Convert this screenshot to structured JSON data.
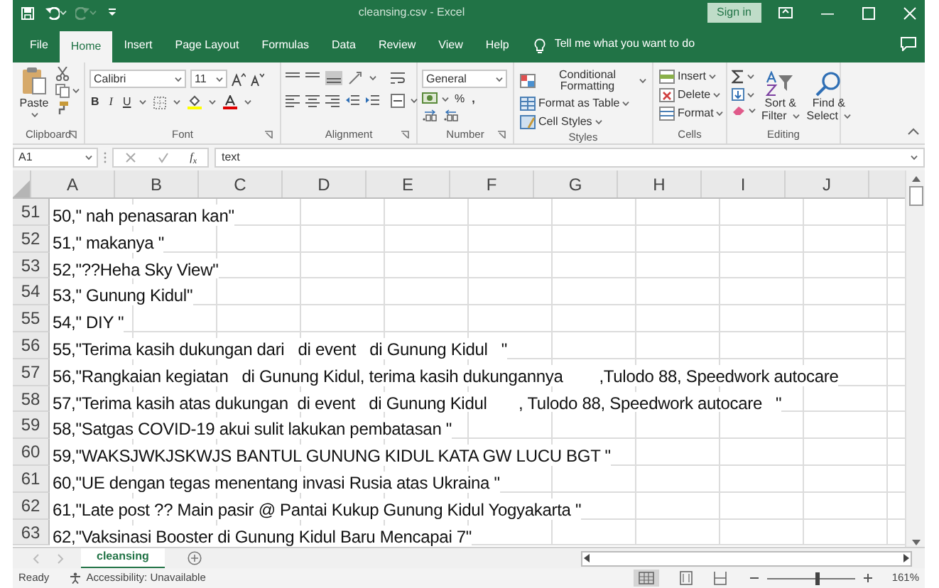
{
  "title_bar": {
    "title": "cleansing.csv  -  Excel",
    "sign_in": "Sign in"
  },
  "ribbon_tabs": [
    {
      "label": "File",
      "selected": false
    },
    {
      "label": "Home",
      "selected": true
    },
    {
      "label": "Insert",
      "selected": false
    },
    {
      "label": "Page Layout",
      "selected": false
    },
    {
      "label": "Formulas",
      "selected": false
    },
    {
      "label": "Data",
      "selected": false
    },
    {
      "label": "Review",
      "selected": false
    },
    {
      "label": "View",
      "selected": false
    },
    {
      "label": "Help",
      "selected": false
    }
  ],
  "tell_me": "Tell me what you want to do",
  "ribbon": {
    "clipboard": {
      "paste": "Paste",
      "label": "Clipboard"
    },
    "font": {
      "font_name": "Calibri",
      "font_size": "11",
      "bold": "B",
      "italic": "I",
      "underline": "U",
      "label": "Font"
    },
    "alignment": {
      "label": "Alignment"
    },
    "number": {
      "format": "General",
      "percent": "%",
      "comma": ",",
      "label": "Number"
    },
    "styles": {
      "items": [
        "Conditional Formatting",
        "Format as Table",
        "Cell Styles"
      ],
      "label": "Styles"
    },
    "cells": {
      "items": [
        "Insert",
        "Delete",
        "Format"
      ],
      "label": "Cells"
    },
    "editing": {
      "sort": [
        "Sort &",
        "Filter"
      ],
      "find": [
        "Find &",
        "Select"
      ],
      "label": "Editing"
    }
  },
  "formula_bar": {
    "name_box": "A1",
    "fx": "f$_{x}$",
    "value": "text"
  },
  "columns": [
    "A",
    "B",
    "C",
    "D",
    "E",
    "F",
    "G",
    "H",
    "I",
    "J"
  ],
  "rows": [
    {
      "number": "51",
      "text": "50,\" nah penasaran kan\""
    },
    {
      "number": "52",
      "text": "51,\" makanya \""
    },
    {
      "number": "53",
      "text": "52,\"??Heha Sky View\""
    },
    {
      "number": "54",
      "text": "53,\" Gunung Kidul\""
    },
    {
      "number": "55",
      "text": "54,\" DIY \""
    },
    {
      "number": "56",
      "text": "55,\"Terima kasih dukungan dari   di event   di Gunung Kidul   \""
    },
    {
      "number": "57",
      "text": "56,\"Rangkaian kegiatan   di Gunung Kidul, terima kasih dukungannya        ,Tulodo 88, Speedwork autocare"
    },
    {
      "number": "58",
      "text": "57,\"Terima kasih atas dukungan  di event   di Gunung Kidul       , Tulodo 88, Speedwork autocare   \""
    },
    {
      "number": "59",
      "text": "58,\"Satgas COVID-19 akui sulit lakukan pembatasan \""
    },
    {
      "number": "60",
      "text": "59,\"WAKSJWKJSKWJS BANTUL GUNUNG KIDUL KATA GW LUCU BGT \""
    },
    {
      "number": "61",
      "text": "60,\"UE dengan tegas menentang invasi Rusia atas Ukraina \""
    },
    {
      "number": "62",
      "text": "61,\"Late post ?? Main pasir @ Pantai Kukup Gunung Kidul Yogyakarta \""
    },
    {
      "number": "63",
      "text": "62,\"Vaksinasi Booster di Gunung Kidul Baru Mencapai 7\""
    }
  ],
  "sheet_tabs": [
    {
      "label": "cleansing",
      "selected": true
    }
  ],
  "status_bar": {
    "mode": "Ready",
    "accessibility": "Accessibility: Unavailable",
    "zoom_slider": {
      "level": 0.57
    },
    "zoom": "161%"
  }
}
